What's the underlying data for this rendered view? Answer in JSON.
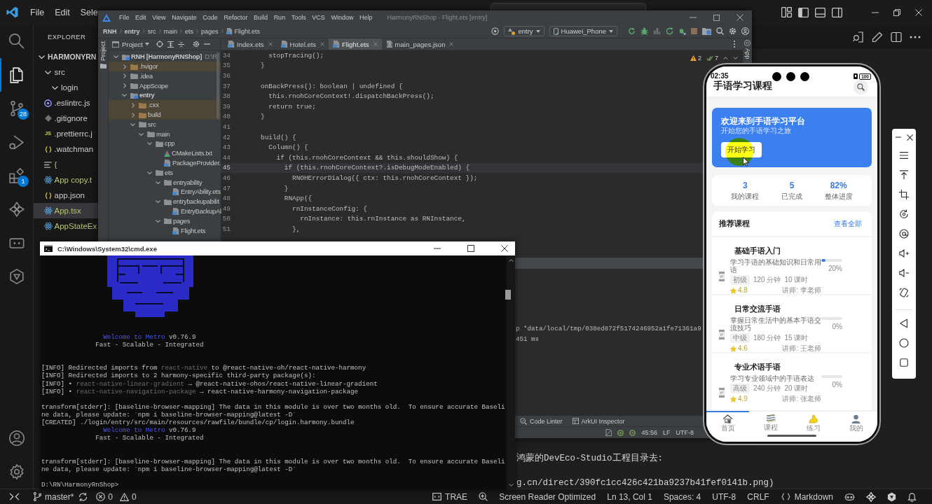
{
  "vscode": {
    "menu": [
      "File",
      "Edit",
      "Sele"
    ],
    "activity_bar": [
      {
        "kind": "search",
        "selected": false
      },
      {
        "kind": "explorer",
        "selected": true
      },
      {
        "kind": "source-control",
        "selected": false,
        "badge": "28"
      },
      {
        "kind": "run-debug",
        "selected": false
      },
      {
        "kind": "extensions",
        "selected": false,
        "badge": "1"
      },
      {
        "kind": "pinwheel",
        "selected": false
      },
      {
        "kind": "dots-box",
        "selected": false
      },
      {
        "kind": "hexagon",
        "selected": false
      }
    ],
    "explorer": {
      "title": "EXPLORER",
      "tree": [
        {
          "label": "HARMONYRN",
          "kind": "root",
          "expanded": true,
          "selected": false,
          "children": [
            {
              "label": "src",
              "expanded": true,
              "selected": false,
              "children": [
                {
                  "label": "login",
                  "expanded": true,
                  "selected": false
                }
              ]
            },
            {
              "label": ".eslintrc.js",
              "kind": "eslint",
              "modified": false,
              "selected": false
            },
            {
              "label": ".gitignore",
              "kind": "git",
              "modified": false,
              "selected": false
            },
            {
              "label": ".prettierrc.j",
              "kind": "js",
              "icon_text": "JS",
              "modified": false,
              "selected": false
            },
            {
              "label": ".watchman",
              "kind": "json",
              "modified": false,
              "selected": false
            },
            {
              "label": "{",
              "kind": "text",
              "modified": true,
              "selected": false
            },
            {
              "label": "App copy.t",
              "kind": "react",
              "modified": true,
              "selected": false
            },
            {
              "label": "app.json",
              "kind": "json",
              "modified": false,
              "selected": false
            },
            {
              "label": "App.tsx",
              "kind": "react",
              "modified": true,
              "selected": true
            },
            {
              "label": "AppStateEx",
              "kind": "react",
              "modified": true,
              "selected": false
            }
          ]
        }
      ]
    },
    "editor_lines": [
      "鸿蒙的DevEco-Studio工程目录去:",
      "g.cn/direct/390fc1cc426c421ba9237b41fef0141b.png)"
    ],
    "status_bar": {
      "branch": "master*",
      "errors": "0",
      "warnings": "0",
      "trae": "TRAE",
      "items": [
        "Screen Reader Optimized",
        "Ln 13, Col 1",
        "Spaces: 4",
        "UTF-8",
        "CRLF"
      ],
      "language": "Markdown"
    }
  },
  "ide": {
    "menu": [
      "File",
      "Edit",
      "View",
      "Navigate",
      "Code",
      "Refactor",
      "Build",
      "Run",
      "Tools",
      "VCS",
      "Window",
      "Help"
    ],
    "title": "HarmonyRNShop - Flight.ets [entry]",
    "breadcrumb": [
      {
        "label": "RNH",
        "kind": "module"
      },
      {
        "label": "entry",
        "kind": "module"
      },
      {
        "label": "src",
        "kind": "folder"
      },
      {
        "label": "main",
        "kind": "folder"
      },
      {
        "label": "ets",
        "kind": "folder"
      },
      {
        "label": "pages",
        "kind": "folder"
      },
      {
        "label": "Flight.ets",
        "kind": "file"
      }
    ],
    "run_config": "entry",
    "device": "Huawei_Phone",
    "left_tool": "Project",
    "right_tool": "App",
    "project": {
      "title": "Project",
      "tree": [
        {
          "label": "RNH [HarmonyRNShop]",
          "path": "D:\\R",
          "kind": "module",
          "expanded": true,
          "excluded": false,
          "selected": false,
          "children": [
            {
              "label": ".hvigor",
              "kind": "folder",
              "expanded": false,
              "excluded": true,
              "selected": false
            },
            {
              "label": ".idea",
              "kind": "folder",
              "expanded": false,
              "excluded": false,
              "selected": false
            },
            {
              "label": "AppScope",
              "kind": "folder",
              "expanded": false,
              "excluded": false,
              "selected": false
            },
            {
              "label": "entry",
              "kind": "module",
              "expanded": true,
              "excluded": false,
              "selected": false,
              "children": [
                {
                  "label": ".cxx",
                  "kind": "folder",
                  "expanded": false,
                  "excluded": true,
                  "selected": false
                },
                {
                  "label": "build",
                  "kind": "folder",
                  "expanded": false,
                  "excluded": true,
                  "selected": false
                },
                {
                  "label": "src",
                  "kind": "folder",
                  "expanded": true,
                  "excluded": false,
                  "selected": false,
                  "children": [
                    {
                      "label": "main",
                      "kind": "folder",
                      "expanded": true,
                      "excluded": false,
                      "selected": false,
                      "children": [
                        {
                          "label": "cpp",
                          "kind": "folder",
                          "expanded": true,
                          "excluded": false,
                          "selected": false,
                          "children": [
                            {
                              "label": "CMakeLists.txt",
                              "kind": "cmake",
                              "excluded": false,
                              "selected": false
                            },
                            {
                              "label": "PackageProvider.",
                              "kind": "source",
                              "excluded": false,
                              "selected": false
                            }
                          ]
                        },
                        {
                          "label": "ets",
                          "kind": "folder",
                          "expanded": true,
                          "excluded": false,
                          "selected": false,
                          "children": [
                            {
                              "label": "entryability",
                              "kind": "folder",
                              "expanded": true,
                              "excluded": false,
                              "selected": false,
                              "children": [
                                {
                                  "label": "EntryAbility.ets",
                                  "kind": "source",
                                  "excluded": false,
                                  "selected": false
                                }
                              ]
                            },
                            {
                              "label": "entrybackupabilit",
                              "kind": "folder",
                              "expanded": true,
                              "excluded": false,
                              "selected": false,
                              "children": [
                                {
                                  "label": "EntryBackupAl",
                                  "kind": "source",
                                  "excluded": false,
                                  "selected": false
                                }
                              ]
                            },
                            {
                              "label": "pages",
                              "kind": "folder",
                              "expanded": true,
                              "excluded": false,
                              "selected": false,
                              "children": [
                                {
                                  "label": "Flight.ets",
                                  "kind": "source",
                                  "excluded": false,
                                  "selected": false
                                }
                              ]
                            }
                          ]
                        }
                      ]
                    }
                  ]
                }
              ]
            }
          ]
        }
      ]
    },
    "tabs": [
      {
        "label": "Index.ets",
        "kind": "ets",
        "selected": false
      },
      {
        "label": "Hotel.ets",
        "kind": "ets",
        "selected": false
      },
      {
        "label": "Flight.ets",
        "kind": "ets",
        "selected": true
      },
      {
        "label": "main_pages.json",
        "kind": "json",
        "selected": false
      }
    ],
    "inspections": {
      "warnings": "2",
      "weak_warnings": "7"
    },
    "code": [
      {
        "number": "34",
        "text": "    stopTracing();",
        "current": false
      },
      {
        "number": "35",
        "text": "  }",
        "current": false
      },
      {
        "number": "36",
        "current": false
      },
      {
        "number": "37",
        "text": "  onBackPress(): boolean | undefined {",
        "current": false
      },
      {
        "number": "38",
        "text": "    this.rnohCoreContext!.dispatchBackPress();",
        "current": false
      },
      {
        "number": "39",
        "text": "    return true;",
        "current": false
      },
      {
        "number": "40",
        "text": "  }",
        "current": false
      },
      {
        "number": "41",
        "current": false
      },
      {
        "number": "42",
        "text": "  build() {",
        "current": false
      },
      {
        "number": "43",
        "text": "    Column() {",
        "current": false
      },
      {
        "number": "44",
        "text": "      if (this.rnohCoreContext && this.shouldShow) {",
        "current": false
      },
      {
        "number": "45",
        "text": "        if (this.rnohCoreContext?.isDebugModeEnabled) {",
        "current": true
      },
      {
        "number": "46",
        "text": "          RNOHErrorDialog({ ctx: this.rnohCoreContext });",
        "current": false
      },
      {
        "number": "47",
        "text": "        }",
        "current": false
      },
      {
        "number": "48",
        "text": "        RNApp({",
        "current": false
      },
      {
        "number": "49",
        "text": "          rnInstanceConfig: {",
        "current": false
      },
      {
        "number": "50",
        "text": "            rnInstance: this.rnInstance as RNInstance,",
        "current": false
      },
      {
        "number": "51",
        "text": "          },",
        "current": false
      }
    ],
    "run_log": [
      "p *data/local/tmp/038ed872f5174246952a1fe71361a9",
      "451 ms"
    ],
    "tool_tabs": [
      {
        "label": "Code Linter",
        "kind": "linter"
      },
      {
        "label": "ArkUI Inspector",
        "kind": "inspector"
      }
    ],
    "status": [
      "45:56",
      "LF",
      "UTF-8"
    ]
  },
  "console": {
    "title": "C:\\Windows\\System32\\cmd.exe",
    "lines": [
      {
        "kind": "text",
        "parts": [
          {
            "text": "                Welcome to Metro",
            "kind": "accent"
          },
          {
            "text": " v0.76.9",
            "kind": "plain"
          }
        ]
      },
      {
        "kind": "text",
        "parts": [
          {
            "text": "              Fast - Scalable - Integrated",
            "kind": "plain"
          }
        ]
      },
      {
        "kind": "blank"
      },
      {
        "kind": "blank"
      },
      {
        "kind": "text",
        "parts": [
          {
            "text": "[INFO] Redirected imports from ",
            "kind": "plain"
          },
          {
            "text": "react-native",
            "kind": "dim"
          },
          {
            "text": " to @react-native-oh/react-native-harmony",
            "kind": "plain"
          }
        ]
      },
      {
        "kind": "text",
        "parts": [
          {
            "text": "[INFO] Redirected imports to 2 harmony-specific third-party package(s):",
            "kind": "plain"
          }
        ]
      },
      {
        "kind": "text",
        "parts": [
          {
            "text": "[INFO] • ",
            "kind": "plain"
          },
          {
            "text": "react-native-linear-gradient",
            "kind": "dim"
          },
          {
            "text": " → @react-native-ohos/react-native-linear-gradient",
            "kind": "plain"
          }
        ]
      },
      {
        "kind": "text",
        "parts": [
          {
            "text": "[INFO] • ",
            "kind": "plain"
          },
          {
            "text": "react-native-navigation-package",
            "kind": "dim"
          },
          {
            "text": " → react-native-harmony-navigation-package",
            "kind": "plain"
          }
        ]
      },
      {
        "kind": "blank"
      },
      {
        "kind": "text",
        "parts": [
          {
            "text": "transform[stderr]: [baseline-browser-mapping] The data in this module is over two months old.  To ensure accurate Baseli",
            "kind": "plain"
          }
        ]
      },
      {
        "kind": "text",
        "parts": [
          {
            "text": "ne data, please update: `npm i baseline-browser-mapping@latest -D`",
            "kind": "plain"
          }
        ]
      },
      {
        "kind": "text",
        "parts": [
          {
            "text": "[CREATED] ./login/entry/src/main/resources/rawfile/bundle/cp/login.harmony.bundle",
            "kind": "plain"
          }
        ]
      },
      {
        "kind": "text",
        "parts": [
          {
            "text": "                Welcome to Metro",
            "kind": "accent"
          },
          {
            "text": " v0.76.9",
            "kind": "plain"
          }
        ]
      },
      {
        "kind": "text",
        "parts": [
          {
            "text": "              Fast - Scalable - Integrated",
            "kind": "plain"
          }
        ]
      },
      {
        "kind": "blank"
      },
      {
        "kind": "blank"
      },
      {
        "kind": "text",
        "parts": [
          {
            "text": "transform[stderr]: [baseline-browser-mapping] The data in this module is over two months old.  To ensure accurate Baseli",
            "kind": "plain"
          }
        ]
      },
      {
        "kind": "text",
        "parts": [
          {
            "text": "ne data, please update: `npm i baseline-browser-mapping@latest -D`",
            "kind": "plain"
          }
        ]
      },
      {
        "kind": "blank"
      },
      {
        "kind": "text",
        "parts": [
          {
            "text": "D:\\RN\\HarmonyRnShop>",
            "kind": "plain"
          }
        ]
      }
    ]
  },
  "phone": {
    "time": "02:35",
    "battery": "100",
    "title": "手语学习课程",
    "banner": {
      "title": "欢迎来到手语学习平台",
      "subtitle": "开始您的手语学习之旅",
      "button": "开始学习"
    },
    "stats": [
      {
        "value": "3",
        "label": "我的课程"
      },
      {
        "value": "5",
        "label": "已完成"
      },
      {
        "value": "82%",
        "label": "整体进度"
      }
    ],
    "section": {
      "title": "推荐课程",
      "link": "查看全部"
    },
    "courses": [
      {
        "title": "基础手语入门",
        "description": "学习手语的基础知识和日常用语",
        "level_tag": "初级",
        "duration": "120 分钟",
        "lessons": "10 课时",
        "rating": "4.8",
        "teacher": "讲师: 李老师",
        "level": 0.2,
        "progress": "20%"
      },
      {
        "title": "日常交流手语",
        "description": "掌握日常生活中的基本手语交流技巧",
        "level_tag": "中级",
        "duration": "180 分钟",
        "lessons": "15 课时",
        "rating": "4.6",
        "teacher": "讲师: 王老师",
        "progress": "0%"
      },
      {
        "title": "专业术语手语",
        "description": "学习专业领域中的手语表达",
        "level_tag": "高级",
        "duration": "240 分钟",
        "lessons": "20 课时",
        "rating": "4.9",
        "teacher": "讲师: 张老师",
        "progress": "0%"
      }
    ],
    "nav": [
      {
        "label": "首页",
        "kind": "home",
        "selected": true
      },
      {
        "label": "课程",
        "kind": "books",
        "selected": false
      },
      {
        "label": "练习",
        "kind": "arm",
        "selected": false
      },
      {
        "label": "我的",
        "kind": "person",
        "selected": false
      }
    ]
  }
}
